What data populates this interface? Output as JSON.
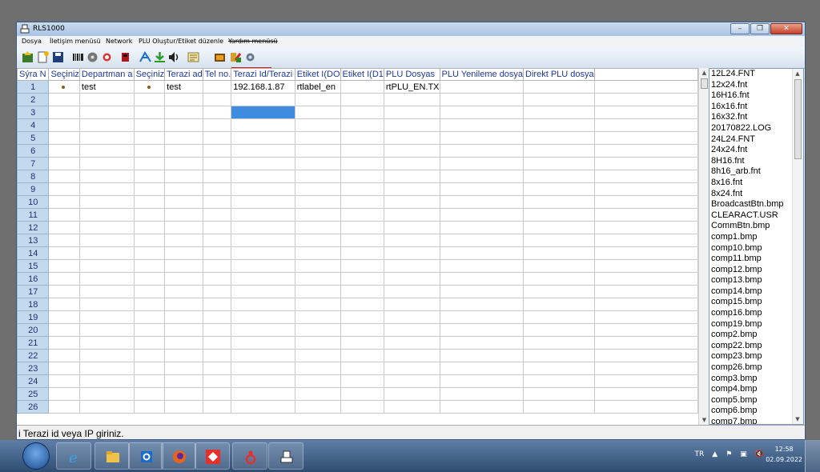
{
  "window": {
    "title": "RLS1000"
  },
  "menu": [
    "Dosya",
    "İletişim menüsü",
    "Network",
    "PLU Oluştur/Etiket düzenle",
    "Yardım menüsü"
  ],
  "grid": {
    "columns": [
      "Sýra N",
      "Seçiniz",
      "Departman a",
      "Seçiniz",
      "Terazi ad",
      "Tel no.",
      "Terazi Id/Terazi",
      "Etiket I(DO",
      "Etiket I(D1",
      "PLU Dosyas",
      "PLU Yenileme dosya",
      "Direkt PLU dosya"
    ],
    "row_numbers": [
      "1",
      "2",
      "3",
      "4",
      "5",
      "6",
      "7",
      "8",
      "9",
      "10",
      "11",
      "12",
      "13",
      "14",
      "15",
      "16",
      "17",
      "18",
      "19",
      "20",
      "21",
      "22",
      "23",
      "24",
      "25",
      "26"
    ],
    "row1": {
      "dept": "test",
      "scale_name": "test",
      "scale_id": "192.168.1.87",
      "label0": "rtlabel_en",
      "plu_file": "rtPLU_EN.TX"
    }
  },
  "files": [
    "12L24.FNT",
    "12x24.fnt",
    "16H16.fnt",
    "16x16.fnt",
    "16x32.fnt",
    "20170822.LOG",
    "24L24.FNT",
    "24x24.fnt",
    "8H16.fnt",
    "8h16_arb.fnt",
    "8x16.fnt",
    "8x24.fnt",
    "BroadcastBtn.bmp",
    "CLEARACT.USR",
    "CommBtn.bmp",
    "comp1.bmp",
    "comp10.bmp",
    "comp11.bmp",
    "comp12.bmp",
    "comp13.bmp",
    "comp14.bmp",
    "comp15.bmp",
    "comp16.bmp",
    "comp19.bmp",
    "comp2.bmp",
    "comp22.bmp",
    "comp23.bmp",
    "comp26.bmp",
    "comp3.bmp",
    "comp4.bmp",
    "comp5.bmp",
    "comp6.bmp",
    "comp7.bmp"
  ],
  "status": {
    "text": "i Terazi id  veya IP giriniz."
  },
  "tray": {
    "lang": "TR",
    "time": "12:58",
    "date": "02.09.2022"
  },
  "colors": {
    "accent": "#3e8cdf",
    "row_header": "#c2d9ee",
    "highlight": "#d21a1a"
  }
}
